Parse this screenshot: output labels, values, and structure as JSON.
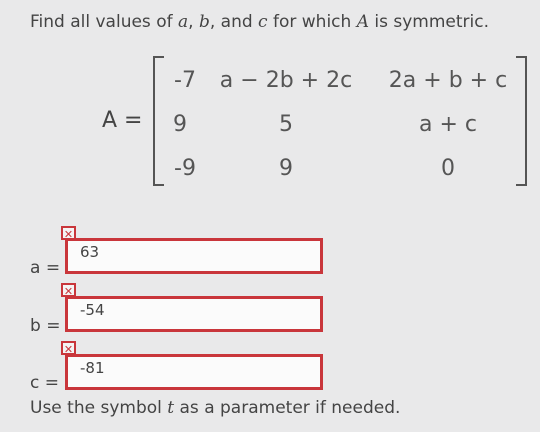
{
  "prompt": {
    "before_a": "Find all values of ",
    "a": "a",
    "sep1": ", ",
    "b": "b",
    "sep2": ", and ",
    "c": "c",
    "mid": " for which ",
    "A": "A",
    "after": " is symmetric."
  },
  "matrix": {
    "label": "A =",
    "rows": [
      [
        "-7",
        "a − 2b + 2c",
        "2a + b + c"
      ],
      [
        "9",
        "5",
        "a + c"
      ],
      [
        "-9",
        "9",
        "0"
      ]
    ]
  },
  "answers": [
    {
      "label": "a =",
      "value": "63",
      "status_icon": "x-mark",
      "status": "incorrect"
    },
    {
      "label": "b =",
      "value": "-54",
      "status_icon": "x-mark",
      "status": "incorrect"
    },
    {
      "label": "c =",
      "value": "-81",
      "status_icon": "x-mark",
      "status": "incorrect"
    }
  ],
  "footer": {
    "before": "Use the symbol ",
    "t": "t",
    "after": " as a parameter if needed."
  },
  "colors": {
    "error_border": "#c9363b",
    "background": "#e9e9ea"
  }
}
